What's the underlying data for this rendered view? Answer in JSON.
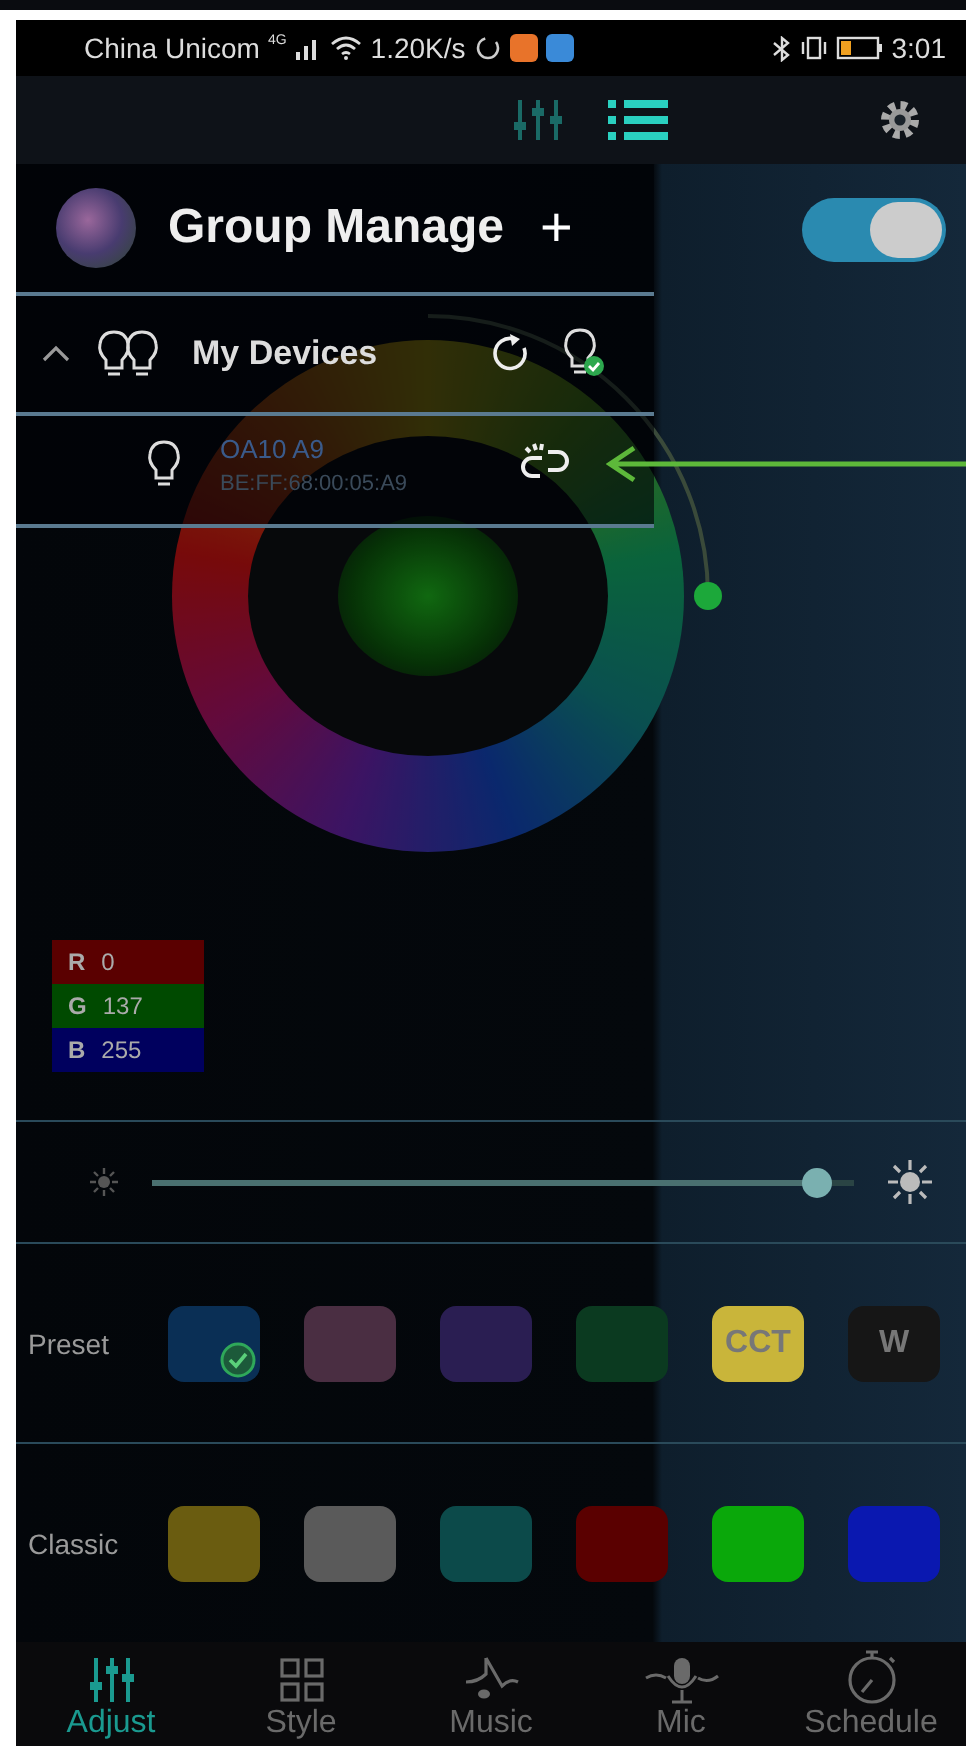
{
  "status_bar": {
    "carrier": "China Unicom",
    "network": "4G",
    "speed": "1.20K/s",
    "time": "3:01"
  },
  "toolbar": {
    "tabs": [
      {
        "kind": "sliders",
        "selected": false
      },
      {
        "kind": "list",
        "selected": true
      }
    ]
  },
  "power_switch": {
    "on": true
  },
  "drawer": {
    "title": "Group Manage",
    "add": "+",
    "groups": [
      {
        "name": "My Devices",
        "expanded": true,
        "devices": [
          {
            "name": "OA10 A9",
            "address": "BE:FF:68:00:05:A9",
            "connected": false
          }
        ]
      }
    ]
  },
  "rgb": [
    {
      "label": "R",
      "value": "0",
      "color": "#5a0000"
    },
    {
      "label": "G",
      "value": "137",
      "color": "#004a00"
    },
    {
      "label": "B",
      "value": "255",
      "color": "#00005e"
    }
  ],
  "brightness": {
    "level": 0.95
  },
  "preset": {
    "label": "Preset",
    "swatches": [
      {
        "kind": "color",
        "color": "#0a2f55",
        "selected": true
      },
      {
        "kind": "color",
        "color": "#4a2e42",
        "selected": false
      },
      {
        "kind": "color",
        "color": "#2a1e52",
        "selected": false
      },
      {
        "kind": "color",
        "color": "#0b3a20",
        "selected": false
      },
      {
        "kind": "text",
        "text": "CCT",
        "color": "#c9b53a",
        "selected": false
      },
      {
        "kind": "text",
        "text": "W",
        "color": "#161616",
        "selected": false
      }
    ]
  },
  "classic": {
    "label": "Classic",
    "swatches": [
      {
        "color": "#6a5c10"
      },
      {
        "color": "#5a5a5a"
      },
      {
        "color": "#0c4a4a"
      },
      {
        "color": "#5a0000"
      },
      {
        "color": "#0aa80a"
      },
      {
        "color": "#0a18b0"
      }
    ]
  },
  "nav": [
    {
      "kind": "adjust",
      "label": "Adjust",
      "selected": true
    },
    {
      "kind": "style",
      "label": "Style",
      "selected": false
    },
    {
      "kind": "music",
      "label": "Music",
      "selected": false
    },
    {
      "kind": "mic",
      "label": "Mic",
      "selected": false
    },
    {
      "kind": "schedule",
      "label": "Schedule",
      "selected": false
    }
  ]
}
